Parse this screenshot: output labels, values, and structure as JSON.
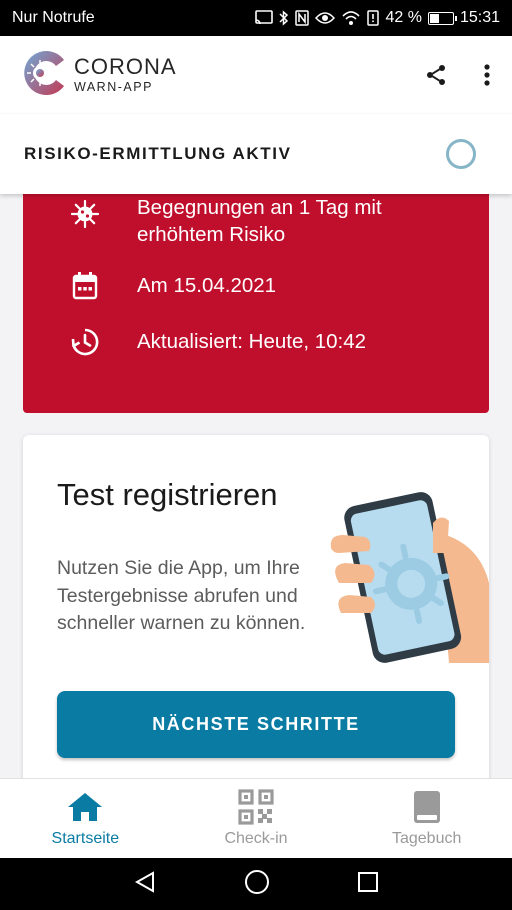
{
  "status_bar": {
    "carrier": "Nur Notrufe",
    "battery": "42 %",
    "time": "15:31",
    "battery_level": 0.42
  },
  "app": {
    "logo_title": "CORONA",
    "logo_subtitle": "WARN-APP"
  },
  "risk_status": {
    "title": "RISIKO-ERMITTLUNG AKTIV"
  },
  "risk_card": {
    "color": "#c00f2d",
    "items": [
      {
        "icon": "virus-icon",
        "text": "Begegnungen an 1 Tag mit erhöhtem Risiko"
      },
      {
        "icon": "calendar-icon",
        "text": "Am 15.04.2021"
      },
      {
        "icon": "update-clock-icon",
        "text": "Aktualisiert: Heute, 10:42"
      }
    ]
  },
  "test_card": {
    "title": "Test registrieren",
    "body": "Nutzen Sie die App, um Ihre Testergebnisse abrufen und schneller warnen zu können.",
    "button": "NÄCHSTE SCHRITTE",
    "accent": "#0a7ca4"
  },
  "bottom_nav": {
    "items": [
      {
        "label": "Startseite",
        "icon": "home-icon",
        "active": true
      },
      {
        "label": "Check-in",
        "icon": "qr-code-icon",
        "active": false
      },
      {
        "label": "Tagebuch",
        "icon": "diary-book-icon",
        "active": false
      }
    ]
  }
}
